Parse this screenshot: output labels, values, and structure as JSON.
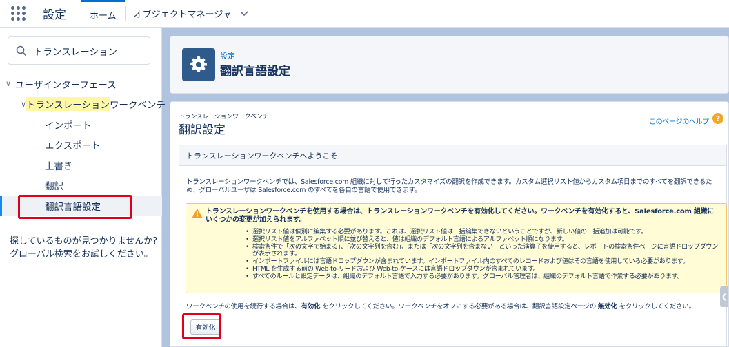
{
  "topbar": {
    "app_name": "設定",
    "tabs": [
      {
        "label": "ホーム"
      },
      {
        "label": "オブジェクトマネージャ"
      }
    ]
  },
  "sidebar": {
    "search_value": "トランスレーション",
    "tree": {
      "root": "ユーザインターフェース",
      "group_highlight": "トランスレーション",
      "group_rest": "ワークベンチ",
      "items": [
        "インポート",
        "エクスポート",
        "上書き",
        "翻訳",
        "翻訳言語設定"
      ]
    },
    "not_found_text": "探しているものが見つかりませんか? グローバル検索をお試しください。"
  },
  "header": {
    "breadcrumb": "設定",
    "title": "翻訳言語設定"
  },
  "content": {
    "sub_breadcrumb": "トランスレーションワークベンチ",
    "title": "翻訳設定",
    "help_link": "このページのヘルプ",
    "panel_title": "トランスレーションワークベンチへようこそ",
    "intro": "トランスレーションワークベンチでは、Salesforce.com 組織に対して行ったカスタマイズの翻訳を作成できます。カスタム選択リスト値からカスタム項目までのすべてを翻訳できるため、グローバルユーザは Salesforce.com のすべてを各自の言語で使用できます。",
    "warning": {
      "title": "トランスレーションワークベンチを使用する場合は、トランスレーションワークベンチを有効化してください。ワークベンチを有効化すると、Salesforce.com 組織にいくつかの変更が加えられます。",
      "items": [
        "選択リスト値は個別に編集する必要があります。これは、選択リスト値は一括編集できないということですが、新しい値の一括追加は可能です。",
        "選択リスト値をアルファベット順に並び替えると、値は組織のデフォルト言語によるアルファベット順になります。",
        "検索条件で「次の文字で始まる」、「次の文字列を含む」、または「次の文字列を含まない」といった演算子を使用すると、レポートの検索条件ページに言語ドロップダウンが表示されます。",
        "インポートファイルには言語ドロップダウンが含まれています。インポートファイル内のすべてのレコードおよび値はその言語を使用している必要があります。",
        "HTML を生成する前の Web-to-リードおよび Web-to-ケースには言語ドロップダウンが含まれています。",
        "すべてのルールと設定データは、組織のデフォルト言語で入力する必要があります。グローバル管理者は、組織のデフォルト言語で作業する必要があります。"
      ]
    },
    "continue": {
      "part1": "ワークベンチの使用を続行する場合は、",
      "enable_word": "有効化",
      "part2": " をクリックしてください。ワークベンチをオフにする必要がある場合は、翻訳言語設定ページの ",
      "disable_word": "無効化",
      "part3": " をクリックしてください。"
    },
    "enable_button": "有効化"
  },
  "colors": {
    "accent": "#0070d2",
    "highlight": "#fff6a8",
    "annotation_red": "#e0001b",
    "warning_bg": "#fffcd6"
  }
}
